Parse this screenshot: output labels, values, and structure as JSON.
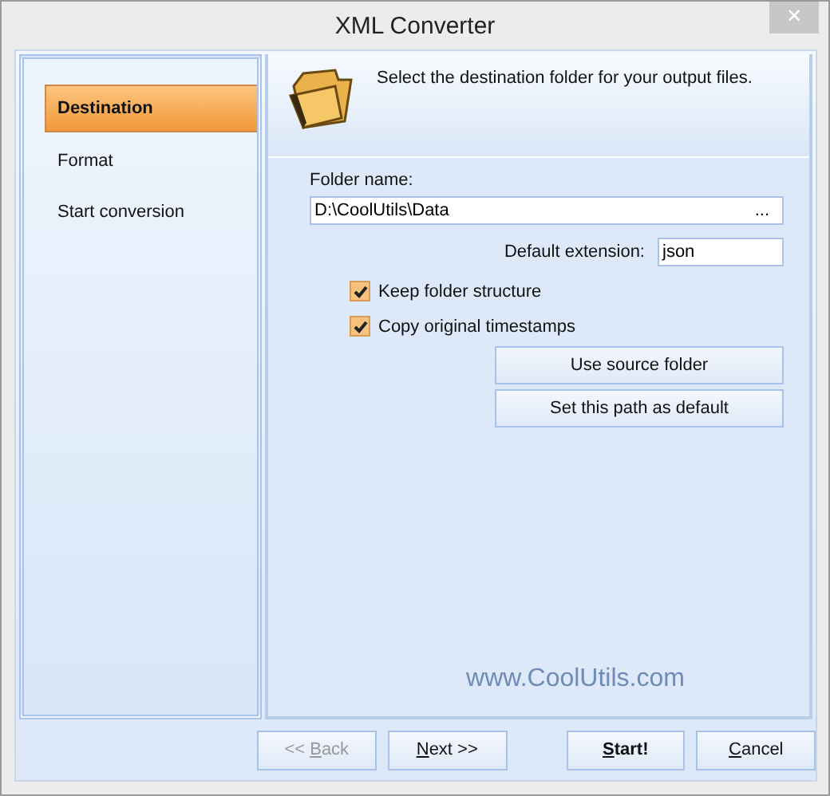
{
  "window": {
    "title": "XML Converter",
    "close": "×"
  },
  "sidebar": {
    "items": [
      {
        "label": "Destination",
        "selected": true
      },
      {
        "label": "Format",
        "selected": false
      },
      {
        "label": "Start conversion",
        "selected": false
      }
    ]
  },
  "header": {
    "text": "Select the destination folder for your output files."
  },
  "folder": {
    "label": "Folder name:",
    "value": "D:\\CoolUtils\\Data",
    "browse": "..."
  },
  "extension": {
    "label": "Default extension:",
    "value": "json"
  },
  "options": [
    {
      "label": "Keep folder structure",
      "checked": true
    },
    {
      "label": "Copy original timestamps",
      "checked": true
    }
  ],
  "actions": [
    "Use source folder",
    "Set this path as default"
  ],
  "website": "www.CoolUtils.com",
  "buttons": [
    {
      "before": "<< ",
      "key": "B",
      "after": "ack",
      "disabled": true,
      "default": false
    },
    {
      "key": "N",
      "after": "ext >>",
      "disabled": false,
      "default": false
    },
    {
      "key": "S",
      "after": "tart!",
      "disabled": false,
      "default": true
    },
    {
      "key": "C",
      "after": "ancel",
      "disabled": false,
      "default": false
    }
  ]
}
